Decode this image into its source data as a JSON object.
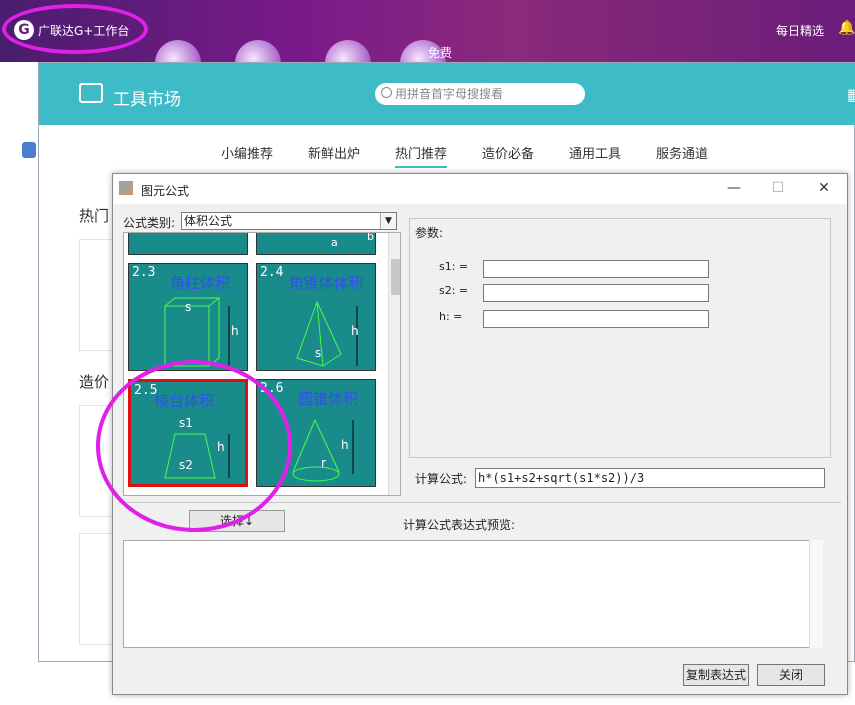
{
  "topbar": {
    "title": "广联达G+工作台",
    "daily": "每日精选",
    "free_badge": "免费",
    "logo_glyph": "G"
  },
  "market": {
    "title": "工具市场",
    "search_placeholder": "用拼音首字母搜搜看",
    "tabs": [
      "小编推荐",
      "新鲜出炉",
      "热门推荐",
      "造价必备",
      "通用工具",
      "服务通道"
    ],
    "active_tab": "热门推荐",
    "section_hot": "热门",
    "section_cost": "造价"
  },
  "dialog": {
    "title": "图元公式",
    "win_min": "—",
    "win_max": "☐",
    "win_close": "✕",
    "category_label": "公式类别:",
    "category_value": "体积公式",
    "tiles": [
      {
        "num": "2.3",
        "name": "角柱体积",
        "labels": [
          "s",
          "h"
        ],
        "selected": false
      },
      {
        "num": "2.4",
        "name": "角锥体体积",
        "labels": [
          "h",
          "s"
        ],
        "selected": false
      },
      {
        "num": "2.5",
        "name": "棱台体积",
        "labels": [
          "s1",
          "h",
          "s2"
        ],
        "selected": true
      },
      {
        "num": "2.6",
        "name": "圆锥体积",
        "labels": [
          "h",
          "r"
        ],
        "selected": false
      }
    ],
    "top_tile_labels": [
      "a",
      "b"
    ],
    "params_label": "参数:",
    "params": [
      {
        "label": "s1: =",
        "value": ""
      },
      {
        "label": "s2: =",
        "value": ""
      },
      {
        "label": "h: =",
        "value": ""
      }
    ],
    "formula_label": "计算公式:",
    "formula_value": "h*(s1+s2+sqrt(s1*s2))/3",
    "select_button": "选择↓",
    "preview_label": "计算公式表达式预览:",
    "copy_button": "复制表达式",
    "close_button": "关闭"
  },
  "colors": {
    "accent": "#3dbcc8",
    "tile": "#1a8b8b",
    "annotation": "#e020e8",
    "selected_border": "#e01010"
  }
}
